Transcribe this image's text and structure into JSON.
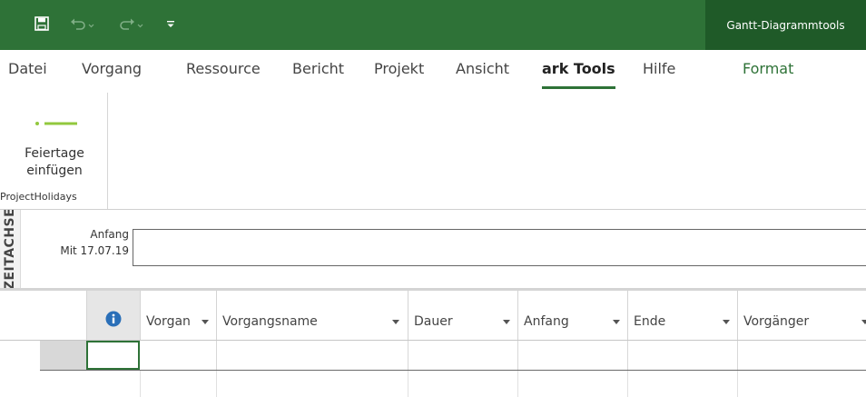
{
  "title_bar": {
    "contextual_label": "Gantt-Diagrammtools",
    "quick_access": [
      "save-icon",
      "undo-icon",
      "redo-icon",
      "customize-icon"
    ]
  },
  "tabs": [
    {
      "label": "Datei"
    },
    {
      "label": "Vorgang"
    },
    {
      "label": "Ressource"
    },
    {
      "label": "Bericht"
    },
    {
      "label": "Projekt"
    },
    {
      "label": "Ansicht"
    },
    {
      "label": "ark Tools",
      "active": true
    },
    {
      "label": "Hilfe"
    },
    {
      "label": "Format",
      "contextual": true
    }
  ],
  "ribbon": {
    "button_line1": "Feiertage",
    "button_line2": "einfügen",
    "group_label": "ProjectHolidays"
  },
  "timeline": {
    "side_label": "ZEITACHSE",
    "start_label": "Anfang",
    "start_date": "Mit 17.07.19"
  },
  "grid": {
    "columns": [
      {
        "label": ""
      },
      {
        "label": "Vorgan"
      },
      {
        "label": "Vorgangsname"
      },
      {
        "label": "Dauer"
      },
      {
        "label": "Anfang"
      },
      {
        "label": "Ende"
      },
      {
        "label": "Vorgänger"
      }
    ]
  },
  "colors": {
    "accent": "#2e7237",
    "contextual_bg": "#1f5a28",
    "holiday_icon": "#92c83e"
  }
}
